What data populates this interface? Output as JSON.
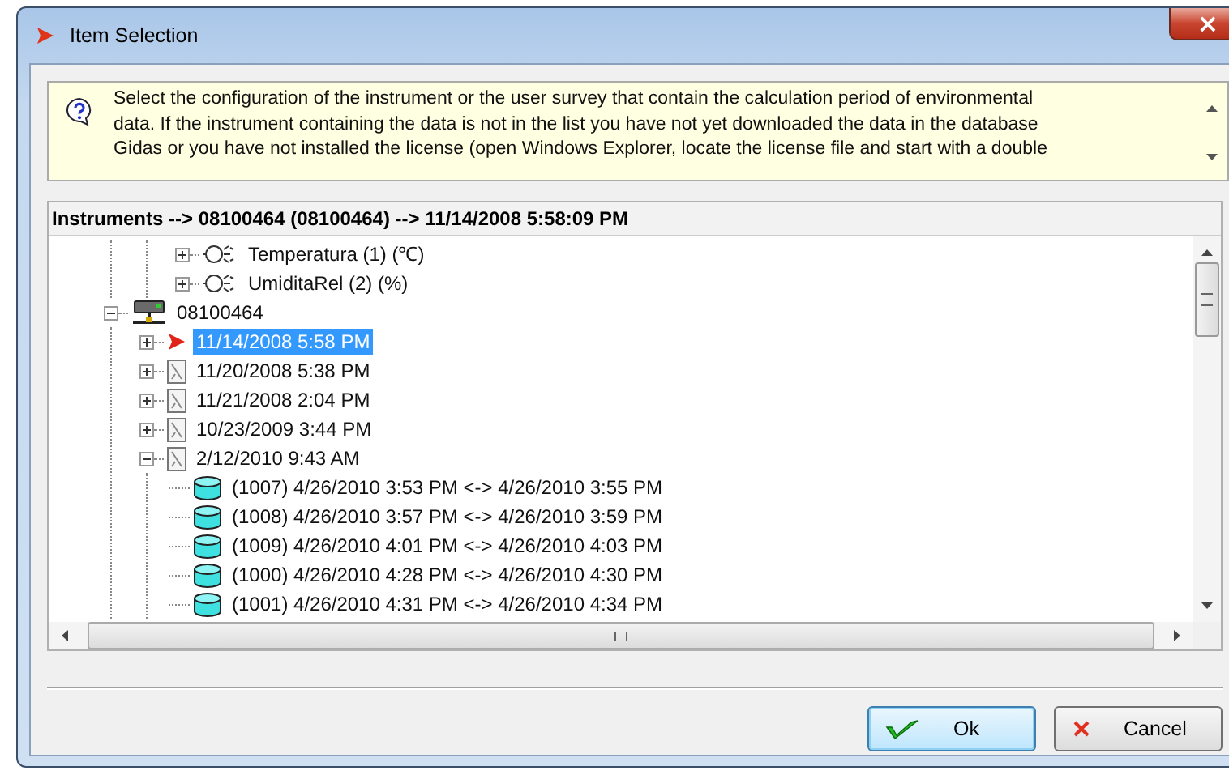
{
  "window": {
    "title": "Item Selection",
    "close": "×"
  },
  "message": {
    "lines": [
      "Select the configuration of the instrument or the user survey that contain the calculation period of environmental",
      "data. If the instrument containing the data is not in the list you have not yet downloaded the data in the database",
      "Gidas or you have not installed the license (open Windows Explorer, locate the license file and start with a double"
    ]
  },
  "path_header": "Instruments --> 08100464 (08100464) --> 11/14/2008 5:58:09 PM",
  "tree": {
    "items": [
      {
        "children": [
          {
            "children": [
              {
                "label": "Temperatura (1) (℃)",
                "kind": "sensor",
                "expanded": false,
                "selected": false
              },
              {
                "label": "UmiditaRel (2) (%)",
                "kind": "sensor",
                "expanded": false,
                "selected": false
              }
            ]
          }
        ]
      },
      {
        "label": "08100464",
        "kind": "instrument",
        "expanded": true,
        "selected": false,
        "children": [
          {
            "label": "11/14/2008 5:58 PM",
            "kind": "current",
            "expanded": false,
            "selected": true
          },
          {
            "label": "11/20/2008 5:38 PM",
            "kind": "survey",
            "expanded": false,
            "selected": false
          },
          {
            "label": "11/21/2008 2:04 PM",
            "kind": "survey",
            "expanded": false,
            "selected": false
          },
          {
            "label": "10/23/2009 3:44 PM",
            "kind": "survey",
            "expanded": false,
            "selected": false
          },
          {
            "label": "2/12/2010 9:43 AM",
            "kind": "survey",
            "expanded": true,
            "selected": false,
            "children": [
              {
                "label": "(1007) 4/26/2010 3:53 PM <-> 4/26/2010 3:55 PM",
                "kind": "dataset",
                "selected": false
              },
              {
                "label": "(1008) 4/26/2010 3:57 PM <-> 4/26/2010 3:59 PM",
                "kind": "dataset",
                "selected": false
              },
              {
                "label": "(1009) 4/26/2010 4:01 PM <-> 4/26/2010 4:03 PM",
                "kind": "dataset",
                "selected": false
              },
              {
                "label": "(1000) 4/26/2010 4:28 PM <-> 4/26/2010 4:30 PM",
                "kind": "dataset",
                "selected": false
              },
              {
                "label": "(1001) 4/26/2010 4:31 PM <-> 4/26/2010 4:34 PM",
                "kind": "dataset",
                "selected": false
              }
            ]
          }
        ]
      }
    ]
  },
  "buttons": [
    {
      "label": "Ok",
      "kind": "ok",
      "focused": true
    },
    {
      "label": "Cancel",
      "kind": "cancel",
      "focused": false
    }
  ]
}
